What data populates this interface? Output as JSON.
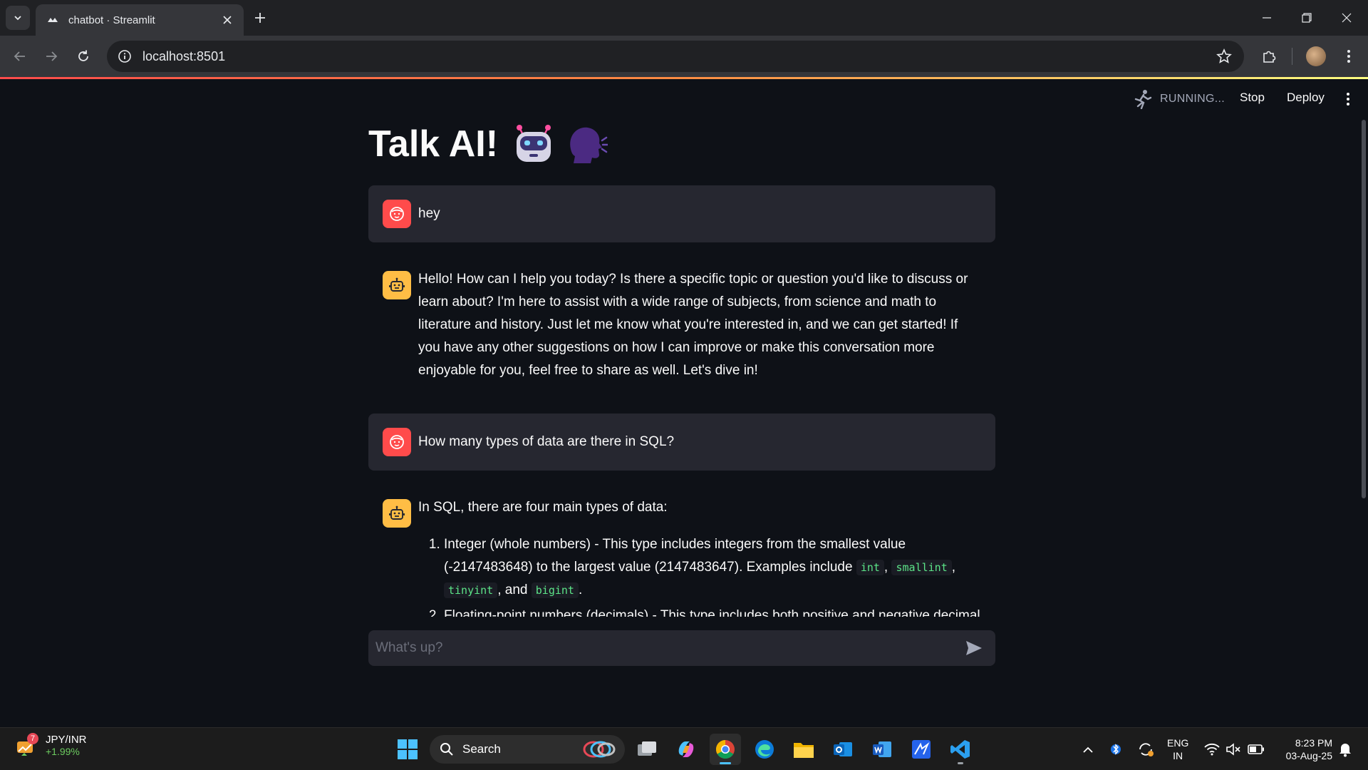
{
  "browser": {
    "tab_title": "chatbot · Streamlit",
    "url": "localhost:8501"
  },
  "app": {
    "status": "RUNNING...",
    "stop_label": "Stop",
    "deploy_label": "Deploy",
    "title": "Talk AI!",
    "title_emoji_robot": "🤖",
    "title_emoji_speaker": "🗣",
    "messages": [
      {
        "role": "user",
        "text": "hey"
      },
      {
        "role": "assistant",
        "text": "Hello! How can I help you today? Is there a specific topic or question you'd like to discuss or learn about? I'm here to assist with a wide range of subjects, from science and math to literature and history. Just let me know what you're interested in, and we can get started! If you have any other suggestions on how I can improve or make this conversation more enjoyable for you, feel free to share as well. Let's dive in!"
      },
      {
        "role": "user",
        "text": "How many types of data are there in SQL?"
      },
      {
        "role": "assistant",
        "intro": "In SQL, there are four main types of data:",
        "item1_text": "Integer (whole numbers) - This type includes integers from the smallest value (-2147483648) to the largest value (2147483647). Examples include",
        "item1_codes": [
          "int",
          "smallint",
          "tinyint",
          "bigint"
        ],
        "item1_sep1": ",",
        "item1_sep2": ",",
        "item1_and": ", and",
        "item1_end": ".",
        "item2_text": "Floating-point numbers (decimals) - This type includes both positive and negative decimal"
      }
    ],
    "chat_placeholder": "What's up?"
  },
  "taskbar": {
    "widget_title": "JPY/INR",
    "widget_change": "+1.99%",
    "widget_badge": "7",
    "search_label": "Search",
    "lang_line1": "ENG",
    "lang_line2": "IN",
    "time": "8:23 PM",
    "date": "03-Aug-25"
  }
}
